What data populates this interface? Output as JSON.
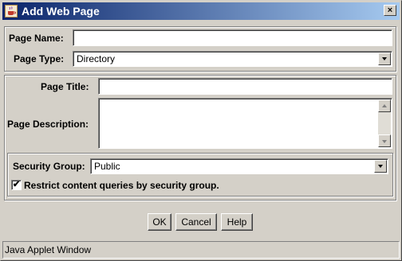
{
  "window": {
    "title": "Add Web Page",
    "close_glyph": "×",
    "icon": "java-cup-icon"
  },
  "top_section": {
    "page_name_label": "Page Name:",
    "page_name_value": "",
    "page_type_label": "Page Type:",
    "page_type_value": "Directory"
  },
  "details_section": {
    "page_title_label": "Page Title:",
    "page_title_value": "",
    "page_description_label": "Page Description:",
    "page_description_value": ""
  },
  "security_section": {
    "security_group_label": "Security Group:",
    "security_group_value": "Public",
    "restrict_label": "Restrict content queries by security group.",
    "restrict_checked": true,
    "check_glyph": "✔"
  },
  "buttons": {
    "ok": "OK",
    "cancel": "Cancel",
    "help": "Help"
  },
  "status_bar": {
    "text": "Java Applet Window"
  }
}
